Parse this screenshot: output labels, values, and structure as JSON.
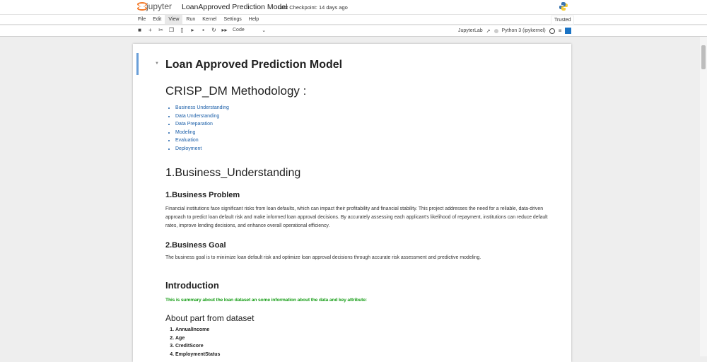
{
  "header": {
    "logo": "jupyter",
    "title": "LoanApproved Prediction Model",
    "checkpoint": "Last Checkpoint: 14 days ago",
    "trusted": "Trusted"
  },
  "menu": [
    "File",
    "Edit",
    "View",
    "Run",
    "Kernel",
    "Settings",
    "Help"
  ],
  "toolbar": {
    "cell_type": "Code",
    "jupyterlab": "JupyterLab",
    "kernel": "Python 3 (ipykernel)"
  },
  "notebook": {
    "title": "Loan Approved Prediction Model",
    "crisp": "CRISP_DM Methodology :",
    "toc": [
      "Business Understanding",
      "Data Understanding",
      "Data Preparation",
      "Modeling",
      "Evaluation",
      "Deployment"
    ],
    "bu": "1.Business_Understanding",
    "problem_h": "1.Business Problem",
    "problem_p": "Financial institutions face significant risks from loan defaults, which can impact their profitability and financial stability. This project addresses the need for a reliable, data-driven approach to predict loan default risk and make informed loan approval decisions. By accurately assessing each applicant's likelihood of repayment, institutions can reduce default rates, improve lending decisions, and enhance overall operational efficiency.",
    "goal_h": "2.Business Goal",
    "goal_p": "The business goal is to minimize loan default risk and optimize loan approval decisions through accurate risk assessment and predictive modeling.",
    "intro": "Introduction",
    "summary": "This is summary about the loan dataset an some information about the data and key attribute:",
    "about": "About part from dataset",
    "attributes": [
      "AnnualIncome",
      "Age",
      "CreditScore",
      "EmploymentStatus"
    ]
  }
}
